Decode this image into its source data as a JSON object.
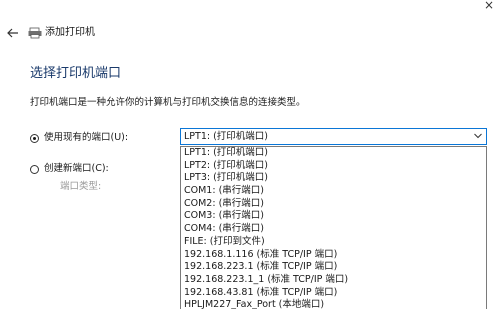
{
  "window": {
    "title": "添加打印机",
    "close_symbol": "×"
  },
  "icons": {
    "back": "back-arrow-icon",
    "printer": "printer-icon",
    "chevron": "chevron-down-icon"
  },
  "page": {
    "title": "选择打印机端口",
    "description": "打印机端口是一种允许你的计算机与打印机交换信息的连接类型。"
  },
  "options": {
    "use_existing": {
      "label": "使用现有的端口(U):",
      "checked": true
    },
    "create_new": {
      "label": "创建新端口(C):",
      "checked": false
    },
    "port_type_label": "端口类型:"
  },
  "port_select": {
    "selected": "LPT1: (打印机端口)",
    "items": [
      "LPT1: (打印机端口)",
      "LPT2: (打印机端口)",
      "LPT3: (打印机端口)",
      "COM1: (串行端口)",
      "COM2: (串行端口)",
      "COM3: (串行端口)",
      "COM4: (串行端口)",
      "FILE: (打印到文件)",
      "192.168.1.116 (标准 TCP/IP 端口)",
      "192.168.223.1 (标准 TCP/IP 端口)",
      "192.168.223.1_1 (标准 TCP/IP 端口)",
      "192.168.43.81 (标准 TCP/IP 端口)",
      "HPLJM227_Fax_Port (本地端口)"
    ]
  },
  "colors": {
    "accent_border": "#0b76d6",
    "title_blue": "#1a3a6b",
    "disabled_text": "#9a9a9a"
  }
}
